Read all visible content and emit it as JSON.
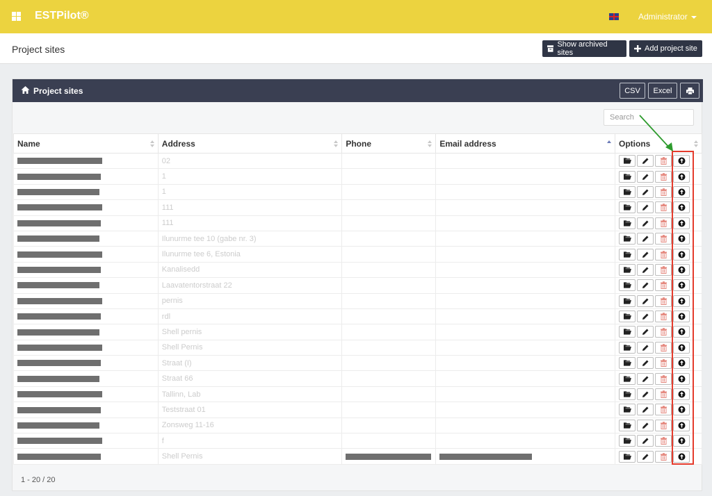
{
  "app": {
    "brand": "ESTPilot®",
    "user": "Administrator"
  },
  "header": {
    "page_title": "Project sites",
    "show_archived_label": "Show archived sites",
    "add_label": "Add project site"
  },
  "panel": {
    "title": "Project sites",
    "csv_label": "CSV",
    "excel_label": "Excel",
    "search_placeholder": "Search"
  },
  "table": {
    "columns": [
      "Name",
      "Address",
      "Phone",
      "Email address",
      "Options"
    ],
    "rows": [
      {
        "address": "02"
      },
      {
        "address": "1"
      },
      {
        "address": "1"
      },
      {
        "address": "111"
      },
      {
        "address": "111"
      },
      {
        "address": "Ilunurme tee 10 (gabe nr. 3)"
      },
      {
        "address": "Ilunurme tee 6, Estonia"
      },
      {
        "address": "Kanalisedd"
      },
      {
        "address": "Laavatentorstraat 22"
      },
      {
        "address": "pernis"
      },
      {
        "address": "rdl"
      },
      {
        "address": "Shell pernis"
      },
      {
        "address": "Shell Pernis"
      },
      {
        "address": "Straat (I)"
      },
      {
        "address": "Straat 66"
      },
      {
        "address": "Tallinn, Lab"
      },
      {
        "address": "Teststraat 01"
      },
      {
        "address": "Zonsweg 11-16"
      },
      {
        "address": "f"
      },
      {
        "address": "Shell Pernis"
      }
    ]
  },
  "footer": {
    "count": "1 - 20 / 20"
  },
  "colors": {
    "topbar": "#ecd33f",
    "panel_header": "#3a3f52",
    "highlight": "#e53b2c",
    "arrow": "#2e9b2e"
  },
  "icons": {
    "open": "folder-open-icon",
    "edit": "pencil-icon",
    "delete": "trash-icon",
    "info": "circle-arrow-up-icon"
  }
}
